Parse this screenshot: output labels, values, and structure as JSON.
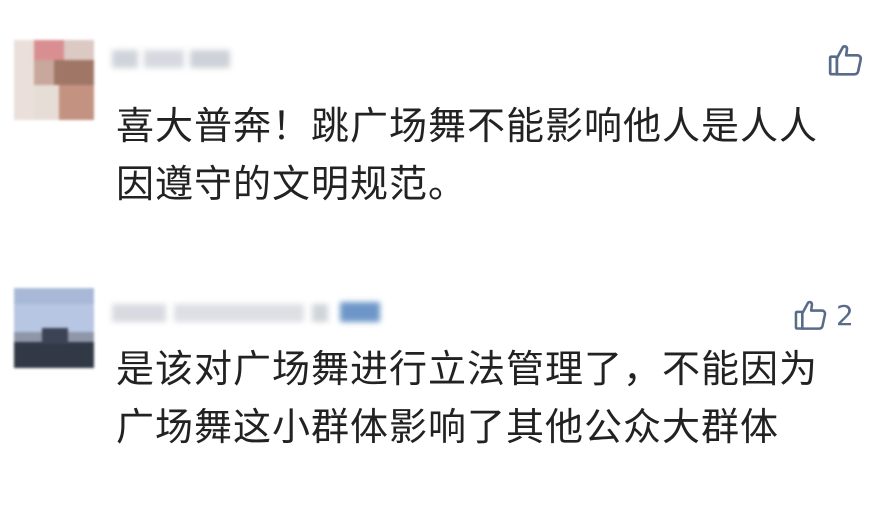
{
  "comments": [
    {
      "text": "喜大普奔！跳广场舞不能影响他人是人人因遵守的文明规范。",
      "likes": ""
    },
    {
      "text": "是该对广场舞进行立法管理了，不能因为广场舞这小群体影响了其他公众大群体",
      "likes": "2"
    }
  ],
  "icons": {
    "like": "thumbs-up-icon"
  },
  "colors": {
    "icon": "#5a6b8a",
    "text": "#222222"
  }
}
